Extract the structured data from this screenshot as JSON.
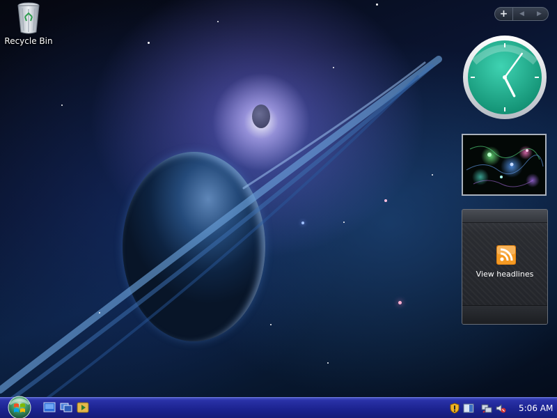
{
  "desktop": {
    "icons": [
      {
        "label": "Recycle Bin",
        "icon": "recycle-bin-icon"
      }
    ]
  },
  "sidebar": {
    "controls": {
      "add": "+",
      "previous": "◀",
      "next": "▶"
    },
    "gadgets": {
      "clock": {
        "time": "5:06"
      },
      "slideshow": {
        "icon": "slideshow-image"
      },
      "feed_headlines": {
        "link_label": "View headlines",
        "icon": "rss-icon"
      }
    }
  },
  "taskbar": {
    "start_button": {
      "icon": "windows-orb-icon"
    },
    "quick_launch": [
      {
        "icon": "show-desktop-icon"
      },
      {
        "icon": "switch-windows-icon"
      },
      {
        "icon": "media-player-icon"
      }
    ],
    "tray": {
      "icons": [
        "security-shield-icon",
        "sidebar-icon",
        "network-icon",
        "volume-muted-icon"
      ],
      "clock": "5:06 AM"
    }
  },
  "colors": {
    "taskbar": "#1c2390",
    "clock_face": "#1aa98a",
    "rss_orange": "#f59a23"
  }
}
